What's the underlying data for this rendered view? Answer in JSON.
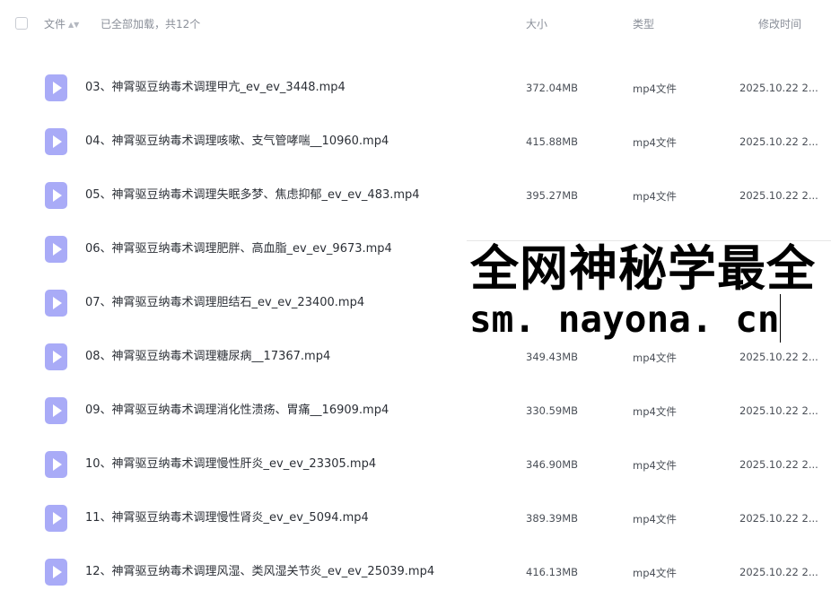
{
  "header": {
    "name_label": "文件",
    "sort_icon": "sort-icon",
    "status": "已全部加载，共12个",
    "size_label": "大小",
    "type_label": "类型",
    "time_label": "修改时间"
  },
  "files": [
    {
      "name": "03、神霄驱豆纳毒术调理甲亢_ev_ev_3448.mp4",
      "size": "372.04MB",
      "type": "mp4文件",
      "time": "2025.10.22 2..."
    },
    {
      "name": "04、神霄驱豆纳毒术调理咳嗽、支气管哮喘__10960.mp4",
      "size": "415.88MB",
      "type": "mp4文件",
      "time": "2025.10.22 2..."
    },
    {
      "name": "05、神霄驱豆纳毒术调理失眠多梦、焦虑抑郁_ev_ev_483.mp4",
      "size": "395.27MB",
      "type": "mp4文件",
      "time": "2025.10.22 2..."
    },
    {
      "name": "06、神霄驱豆纳毒术调理肥胖、高血脂_ev_ev_9673.mp4",
      "size": "",
      "type": "",
      "time": ""
    },
    {
      "name": "07、神霄驱豆纳毒术调理胆结石_ev_ev_23400.mp4",
      "size": "",
      "type": "",
      "time": ""
    },
    {
      "name": "08、神霄驱豆纳毒术调理糖尿病__17367.mp4",
      "size": "349.43MB",
      "type": "mp4文件",
      "time": "2025.10.22 2..."
    },
    {
      "name": "09、神霄驱豆纳毒术调理消化性溃疡、胃痛__16909.mp4",
      "size": "330.59MB",
      "type": "mp4文件",
      "time": "2025.10.22 2..."
    },
    {
      "name": "10、神霄驱豆纳毒术调理慢性肝炎_ev_ev_23305.mp4",
      "size": "346.90MB",
      "type": "mp4文件",
      "time": "2025.10.22 2..."
    },
    {
      "name": "11、神霄驱豆纳毒术调理慢性肾炎_ev_ev_5094.mp4",
      "size": "389.39MB",
      "type": "mp4文件",
      "time": "2025.10.22 2..."
    },
    {
      "name": "12、神霄驱豆纳毒术调理风湿、类风湿关节炎_ev_ev_25039.mp4",
      "size": "416.13MB",
      "type": "mp4文件",
      "time": "2025.10.22 2..."
    }
  ],
  "file_icon": "video-file-icon",
  "watermark": {
    "line1": "全网神秘学最全",
    "line2": "sm. nayona. cn"
  }
}
